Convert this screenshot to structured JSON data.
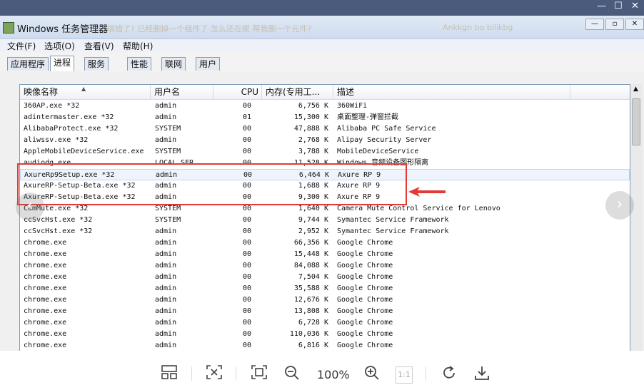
{
  "window": {
    "title": "Windows 任务管理器",
    "notice_a": "搞错了? 已经删掉一个组件了 怎么还在呢 帮我删一个元件?",
    "notice_b": "Ankkgn bo bilikbg"
  },
  "menu": [
    "文件(F)",
    "选项(O)",
    "查看(V)",
    "帮助(H)"
  ],
  "tabs": [
    "应用程序",
    "进程",
    "服务",
    "性能",
    "联网",
    "用户"
  ],
  "active_tab": "进程",
  "columns": [
    "映像名称",
    "用户名",
    "CPU",
    "内存(专用工...",
    "描述"
  ],
  "rows": [
    [
      "360AP.exe *32",
      "admin",
      "00",
      "6,756 K",
      "360WiFi"
    ],
    [
      "adintermaster.exe *32",
      "admin",
      "01",
      "15,300 K",
      "桌面整理-弹窗拦截"
    ],
    [
      "AlibabaProtect.exe *32",
      "SYSTEM",
      "00",
      "47,888 K",
      "Alibaba PC Safe Service"
    ],
    [
      "aliwssv.exe *32",
      "admin",
      "00",
      "2,768 K",
      "Alipay Security Server"
    ],
    [
      "AppleMobileDeviceService.exe",
      "SYSTEM",
      "00",
      "3,788 K",
      "MobileDeviceService"
    ],
    [
      "audiodg.exe",
      "LOCAL SER...",
      "00",
      "11,528 K",
      "Windows 音频设备图形隔离"
    ],
    [
      "AxureRp9Setup.exe *32",
      "admin",
      "00",
      "6,464 K",
      "Axure RP 9"
    ],
    [
      "AxureRP-Setup-Beta.exe *32",
      "admin",
      "00",
      "1,688 K",
      "Axure RP 9"
    ],
    [
      "AxureRP-Setup-Beta.exe *32",
      "admin",
      "00",
      "9,300 K",
      "Axure RP 9"
    ],
    [
      "CamMute.exe *32",
      "SYSTEM",
      "00",
      "1,640 K",
      "Camera Mute Control Service for Lenovo"
    ],
    [
      "ccSvcHst.exe *32",
      "SYSTEM",
      "00",
      "9,744 K",
      "Symantec Service Framework"
    ],
    [
      "ccSvcHst.exe *32",
      "admin",
      "00",
      "2,952 K",
      "Symantec Service Framework"
    ],
    [
      "chrome.exe",
      "admin",
      "00",
      "66,356 K",
      "Google Chrome"
    ],
    [
      "chrome.exe",
      "admin",
      "00",
      "15,448 K",
      "Google Chrome"
    ],
    [
      "chrome.exe",
      "admin",
      "00",
      "84,088 K",
      "Google Chrome"
    ],
    [
      "chrome.exe",
      "admin",
      "00",
      "7,504 K",
      "Google Chrome"
    ],
    [
      "chrome.exe",
      "admin",
      "00",
      "35,588 K",
      "Google Chrome"
    ],
    [
      "chrome.exe",
      "admin",
      "00",
      "12,676 K",
      "Google Chrome"
    ],
    [
      "chrome.exe",
      "admin",
      "00",
      "13,808 K",
      "Google Chrome"
    ],
    [
      "chrome.exe",
      "admin",
      "00",
      "6,728 K",
      "Google Chrome"
    ],
    [
      "chrome.exe",
      "admin",
      "00",
      "110,036 K",
      "Google Chrome"
    ],
    [
      "chrome.exe",
      "admin",
      "00",
      "6,816 K",
      "Google Chrome"
    ]
  ],
  "selected_row": 6,
  "viewer": {
    "zoom": "100%",
    "actual_size": "1:1"
  },
  "colors": {
    "highlight_box": "#e53935"
  }
}
